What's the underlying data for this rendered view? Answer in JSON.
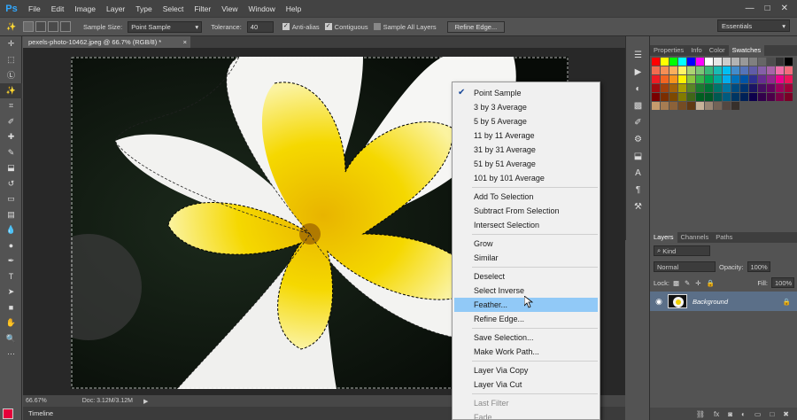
{
  "menubar": {
    "logo": "Ps",
    "items": [
      "File",
      "Edit",
      "Image",
      "Layer",
      "Type",
      "Select",
      "Filter",
      "View",
      "Window",
      "Help"
    ]
  },
  "options": {
    "sample_size_label": "Sample Size:",
    "sample_size_value": "Point Sample",
    "tolerance_label": "Tolerance:",
    "tolerance_value": "40",
    "anti_alias_label": "Anti-alias",
    "anti_alias_checked": true,
    "contiguous_label": "Contiguous",
    "contiguous_checked": true,
    "sample_all_layers_label": "Sample All Layers",
    "sample_all_layers_checked": false,
    "refine_edge_button": "Refine Edge...",
    "workspace": "Essentials"
  },
  "document": {
    "tab_title": "pexels-photo-10462.jpeg @ 66.7% (RGB/8) *",
    "zoom": "66.67%",
    "doc_size": "Doc: 3.12M/3.12M",
    "timeline_label": "Timeline"
  },
  "context_menu": {
    "items": [
      {
        "label": "Point Sample",
        "checked": true
      },
      {
        "label": "3 by 3 Average"
      },
      {
        "label": "5 by 5 Average"
      },
      {
        "label": "11 by 11 Average"
      },
      {
        "label": "31 by 31 Average"
      },
      {
        "label": "51 by 51 Average"
      },
      {
        "label": "101 by 101 Average"
      },
      {
        "sep": true
      },
      {
        "label": "Add To Selection"
      },
      {
        "label": "Subtract From Selection"
      },
      {
        "label": "Intersect Selection"
      },
      {
        "sep": true
      },
      {
        "label": "Grow"
      },
      {
        "label": "Similar"
      },
      {
        "sep": true
      },
      {
        "label": "Deselect"
      },
      {
        "label": "Select Inverse"
      },
      {
        "label": "Feather...",
        "hover": true
      },
      {
        "label": "Refine Edge..."
      },
      {
        "sep": true
      },
      {
        "label": "Save Selection..."
      },
      {
        "label": "Make Work Path..."
      },
      {
        "sep": true
      },
      {
        "label": "Layer Via Copy"
      },
      {
        "label": "Layer Via Cut"
      },
      {
        "sep": true
      },
      {
        "label": "Last Filter",
        "disabled": true
      },
      {
        "label": "Fade...",
        "disabled": true
      }
    ]
  },
  "top_panel": {
    "tabs": [
      "Properties",
      "Info",
      "Color",
      "Swatches"
    ],
    "active_tab": "Swatches"
  },
  "layers_panel": {
    "tabs": [
      "Layers",
      "Channels",
      "Paths"
    ],
    "active_tab": "Layers",
    "filter_kind": "Kind",
    "blend_mode": "Normal",
    "opacity_label": "Opacity:",
    "opacity_value": "100%",
    "lock_label": "Lock:",
    "fill_label": "Fill:",
    "fill_value": "100%",
    "layer_name": "Background"
  },
  "colors": {
    "foreground": "#e4003a",
    "background": "#ffffff",
    "menu_hover": "#91c9f7",
    "layer_selected": "#5b6f88"
  }
}
